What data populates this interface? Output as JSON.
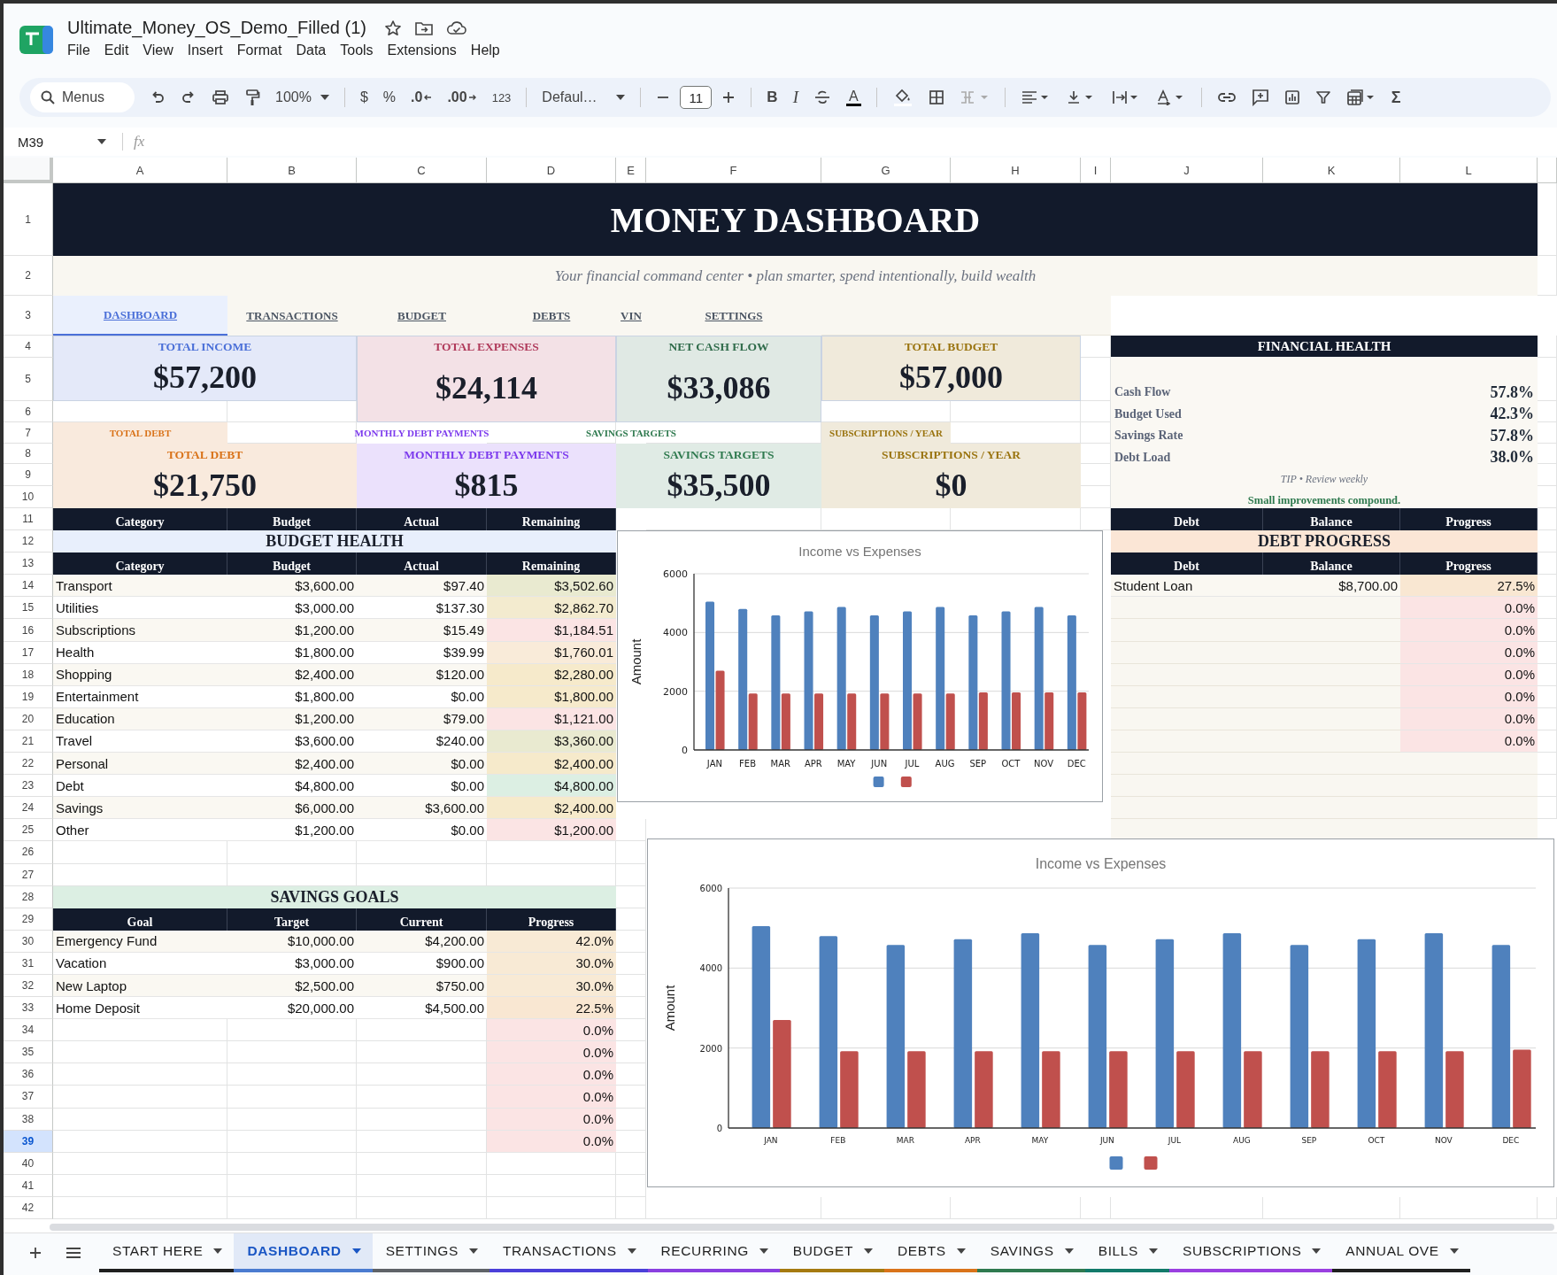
{
  "document": {
    "title": "Ultimate_Money_OS_Demo_Filled (1)"
  },
  "menu": [
    "File",
    "Edit",
    "View",
    "Insert",
    "Format",
    "Data",
    "Tools",
    "Extensions",
    "Help"
  ],
  "toolbar": {
    "search_placeholder": "Menus",
    "zoom": "100%",
    "currency": "$",
    "percent": "%",
    "decrease_decimals": ".0",
    "increase_decimals": ".00",
    "number_format": "123",
    "font": "Defaul…",
    "font_size": "11",
    "bold": "B",
    "italic": "I",
    "text_color": "A",
    "functions": "Σ"
  },
  "formula_bar": {
    "name_box": "M39",
    "fx": "fx"
  },
  "column_headers": [
    "A",
    "B",
    "C",
    "D",
    "E",
    "F",
    "G",
    "H",
    "I",
    "J",
    "K",
    "L"
  ],
  "row_headers": [
    {
      "label": "1",
      "selected": false
    },
    {
      "label": "2",
      "selected": false
    },
    {
      "label": "3",
      "selected": false
    },
    {
      "label": "4",
      "selected": false
    },
    {
      "label": "5",
      "selected": false
    },
    {
      "label": "6",
      "selected": false
    },
    {
      "label": "7",
      "selected": false
    },
    {
      "label": "8",
      "selected": false
    },
    {
      "label": "9",
      "selected": false
    },
    {
      "label": "10",
      "selected": false
    },
    {
      "label": "11",
      "selected": false
    },
    {
      "label": "12",
      "selected": false
    },
    {
      "label": "13",
      "selected": false
    },
    {
      "label": "14",
      "selected": false
    },
    {
      "label": "15",
      "selected": false
    },
    {
      "label": "16",
      "selected": false
    },
    {
      "label": "17",
      "selected": false
    },
    {
      "label": "18",
      "selected": false
    },
    {
      "label": "19",
      "selected": false
    },
    {
      "label": "20",
      "selected": false
    },
    {
      "label": "21",
      "selected": false
    },
    {
      "label": "22",
      "selected": false
    },
    {
      "label": "23",
      "selected": false
    },
    {
      "label": "24",
      "selected": false
    },
    {
      "label": "25",
      "selected": false
    },
    {
      "label": "26",
      "selected": false
    },
    {
      "label": "27",
      "selected": false
    },
    {
      "label": "28",
      "selected": false
    },
    {
      "label": "29",
      "selected": false
    },
    {
      "label": "30",
      "selected": false
    },
    {
      "label": "31",
      "selected": false
    },
    {
      "label": "32",
      "selected": false
    },
    {
      "label": "33",
      "selected": false
    },
    {
      "label": "34",
      "selected": false
    },
    {
      "label": "35",
      "selected": false
    },
    {
      "label": "36",
      "selected": false
    },
    {
      "label": "37",
      "selected": false
    },
    {
      "label": "38",
      "selected": false
    },
    {
      "label": "39",
      "selected": true
    },
    {
      "label": "40",
      "selected": false
    },
    {
      "label": "41",
      "selected": false
    },
    {
      "label": "42",
      "selected": false
    }
  ],
  "dashboard": {
    "title": "MONEY DASHBOARD",
    "subtitle": "Your financial command center • plan smarter, spend intentionally, build wealth",
    "nav_links": [
      {
        "label": "DASHBOARD",
        "selected": true
      },
      {
        "label": "TRANSACTIONS",
        "selected": false
      },
      {
        "label": "BUDGET",
        "selected": false
      },
      {
        "label": "DEBTS",
        "selected": false
      },
      {
        "label": "VIN",
        "selected": false
      },
      {
        "label": "SETTINGS",
        "selected": false
      }
    ],
    "summary_cards": [
      {
        "label": "TOTAL INCOME",
        "value": "$57,200",
        "color": "#4a6fd8"
      },
      {
        "label": "TOTAL EXPENSES",
        "value": "$24,114",
        "color": "#b03a5b"
      },
      {
        "label": "NET CASH FLOW",
        "value": "$33,086",
        "color": "#2f6b4a"
      },
      {
        "label": "TOTAL BUDGET",
        "value": "$57,000",
        "color": "#9a7410"
      }
    ],
    "secondary_cards": [
      {
        "caption": "TOTAL DEBT",
        "label": "TOTAL DEBT",
        "value": "$21,750",
        "color": "#d9731a"
      },
      {
        "caption": "MONTHLY DEBT PAYMENTS",
        "label": "MONTHLY DEBT PAYMENTS",
        "value": "$815",
        "color": "#7c3aed"
      },
      {
        "caption": "SAVINGS TARGETS",
        "label": "SAVINGS TARGETS",
        "value": "$35,500",
        "color": "#2f7a4f"
      },
      {
        "caption": "SUBSCRIPTIONS / YEAR",
        "label": "SUBSCRIPTIONS / YEAR",
        "value": "$0",
        "color": "#9a7410"
      }
    ],
    "financial_health": {
      "title": "FINANCIAL HEALTH",
      "metrics": [
        {
          "label": "Cash Flow",
          "value": "57.8%"
        },
        {
          "label": "Budget Used",
          "value": "42.3%"
        },
        {
          "label": "Savings Rate",
          "value": "57.8%"
        },
        {
          "label": "Debt Load",
          "value": "38.0%"
        }
      ],
      "tip": "TIP • Review weekly",
      "note": "Small improvements compound."
    },
    "budget_health": {
      "header_above": [
        "Category",
        "Budget",
        "Actual",
        "Remaining"
      ],
      "title": "BUDGET HEALTH",
      "columns": [
        "Category",
        "Budget",
        "Actual",
        "Remaining"
      ],
      "rows": [
        {
          "category": "Transport",
          "budget": "$3,600.00",
          "actual": "$97.40",
          "remaining": "$3,502.60",
          "color": "#e9ead0"
        },
        {
          "category": "Utilities",
          "budget": "$3,000.00",
          "actual": "$137.30",
          "remaining": "$2,862.70",
          "color": "#f3ebcf"
        },
        {
          "category": "Subscriptions",
          "budget": "$1,200.00",
          "actual": "$15.49",
          "remaining": "$1,184.51",
          "color": "#fbe4e4"
        },
        {
          "category": "Health",
          "budget": "$1,800.00",
          "actual": "$39.99",
          "remaining": "$1,760.01",
          "color": "#f9ebd9"
        },
        {
          "category": "Shopping",
          "budget": "$2,400.00",
          "actual": "$120.00",
          "remaining": "$2,280.00",
          "color": "#f6eacb"
        },
        {
          "category": "Entertainment",
          "budget": "$1,800.00",
          "actual": "$0.00",
          "remaining": "$1,800.00",
          "color": "#f6eacb"
        },
        {
          "category": "Education",
          "budget": "$1,200.00",
          "actual": "$79.00",
          "remaining": "$1,121.00",
          "color": "#fbe4e4"
        },
        {
          "category": "Travel",
          "budget": "$3,600.00",
          "actual": "$240.00",
          "remaining": "$3,360.00",
          "color": "#e9ead0"
        },
        {
          "category": "Personal",
          "budget": "$2,400.00",
          "actual": "$0.00",
          "remaining": "$2,400.00",
          "color": "#f6eacb"
        },
        {
          "category": "Debt",
          "budget": "$4,800.00",
          "actual": "$0.00",
          "remaining": "$4,800.00",
          "color": "#dcefe3"
        },
        {
          "category": "Savings",
          "budget": "$6,000.00",
          "actual": "$3,600.00",
          "remaining": "$2,400.00",
          "color": "#f6eacb"
        },
        {
          "category": "Other",
          "budget": "$1,200.00",
          "actual": "$0.00",
          "remaining": "$1,200.00",
          "color": "#fbe4e4"
        }
      ]
    },
    "savings_goals": {
      "title": "SAVINGS GOALS",
      "columns": [
        "Goal",
        "Target",
        "Current",
        "Progress"
      ],
      "rows": [
        {
          "goal": "Emergency Fund",
          "target": "$10,000.00",
          "current": "$4,200.00",
          "progress": "42.0%",
          "color": "#f8ead5"
        },
        {
          "goal": "Vacation",
          "target": "$3,000.00",
          "current": "$900.00",
          "progress": "30.0%",
          "color": "#f8ead5"
        },
        {
          "goal": "New Laptop",
          "target": "$2,500.00",
          "current": "$750.00",
          "progress": "30.0%",
          "color": "#f8ead5"
        },
        {
          "goal": "Home Deposit",
          "target": "$20,000.00",
          "current": "$4,500.00",
          "progress": "22.5%",
          "color": "#f9e7d2"
        },
        {
          "progress": "0.0%",
          "color": "#fbe4e4"
        },
        {
          "progress": "0.0%",
          "color": "#fbe4e4"
        },
        {
          "progress": "0.0%",
          "color": "#fbe4e4"
        },
        {
          "progress": "0.0%",
          "color": "#fbe4e4"
        },
        {
          "progress": "0.0%",
          "color": "#fbe4e4"
        },
        {
          "progress": "0.0%",
          "color": "#fbe4e4"
        }
      ]
    },
    "debt_progress": {
      "header_above": [
        "Debt",
        "Balance",
        "Progress"
      ],
      "title": "DEBT PROGRESS",
      "columns": [
        "Debt",
        "Balance",
        "Progress"
      ],
      "rows": [
        {
          "debt": "Student Loan",
          "balance": "$8,700.00",
          "progress": "27.5%",
          "color": "#f9e7d2"
        },
        {
          "progress": "0.0%",
          "color": "#fbe4e4"
        },
        {
          "progress": "0.0%",
          "color": "#fbe4e4"
        },
        {
          "progress": "0.0%",
          "color": "#fbe4e4"
        },
        {
          "progress": "0.0%",
          "color": "#fbe4e4"
        },
        {
          "progress": "0.0%",
          "color": "#fbe4e4"
        },
        {
          "progress": "0.0%",
          "color": "#fbe4e4"
        },
        {
          "progress": "0.0%",
          "color": "#fbe4e4"
        }
      ]
    },
    "charts": [
      {
        "chart_data": {
          "type": "bar",
          "title": "Income vs Expenses",
          "ylabel": "Amount",
          "categories": [
            "JAN",
            "FEB",
            "MAR",
            "APR",
            "MAY",
            "JUN",
            "JUL",
            "AUG",
            "SEP",
            "OCT",
            "NOV",
            "DEC"
          ],
          "ylim": [
            0,
            6000
          ],
          "yticks": [
            0,
            2000,
            4000,
            6000
          ],
          "series": [
            {
              "color": "#4f81bd",
              "values": [
                5050,
                4800,
                4580,
                4720,
                4870,
                4580,
                4720,
                4870,
                4580,
                4720,
                4870,
                4580
              ]
            },
            {
              "color": "#c0504d",
              "values": [
                2700,
                1920,
                1920,
                1920,
                1920,
                1920,
                1920,
                1920,
                1960,
                1960,
                1960,
                1960
              ]
            }
          ]
        }
      },
      {
        "chart_data": {
          "type": "bar",
          "title": "Income vs Expenses",
          "ylabel": "Amount",
          "categories": [
            "JAN",
            "FEB",
            "MAR",
            "APR",
            "MAY",
            "JUN",
            "JUL",
            "AUG",
            "SEP",
            "OCT",
            "NOV",
            "DEC"
          ],
          "ylim": [
            0,
            6000
          ],
          "yticks": [
            0,
            2000,
            4000,
            6000
          ],
          "series": [
            {
              "color": "#4f81bd",
              "values": [
                5050,
                4800,
                4580,
                4720,
                4870,
                4580,
                4720,
                4870,
                4580,
                4720,
                4870,
                4580
              ]
            },
            {
              "color": "#c0504d",
              "values": [
                2700,
                1920,
                1920,
                1920,
                1920,
                1920,
                1920,
                1920,
                1920,
                1920,
                1920,
                1960
              ]
            }
          ]
        }
      }
    ]
  },
  "sheet_tabs": [
    {
      "label": "START HERE",
      "selected": false,
      "color": "#1f1f1f"
    },
    {
      "label": "DASHBOARD",
      "selected": true,
      "color": "#4a7bd0"
    },
    {
      "label": "SETTINGS",
      "selected": false,
      "color": "#5f6368"
    },
    {
      "label": "TRANSACTIONS",
      "selected": false,
      "color": "#4b3fd9"
    },
    {
      "label": "RECURRING",
      "selected": false,
      "color": "#8a3fe0"
    },
    {
      "label": "BUDGET",
      "selected": false,
      "color": "#a57a10"
    },
    {
      "label": "DEBTS",
      "selected": false,
      "color": "#d9731a"
    },
    {
      "label": "SAVINGS",
      "selected": false,
      "color": "#2f7a4f"
    },
    {
      "label": "BILLS",
      "selected": false,
      "color": "#127a6a"
    },
    {
      "label": "SUBSCRIPTIONS",
      "selected": false,
      "color": "#9a3fe0"
    },
    {
      "label": "ANNUAL OVE",
      "selected": false,
      "color": "#1f1f1f"
    }
  ]
}
